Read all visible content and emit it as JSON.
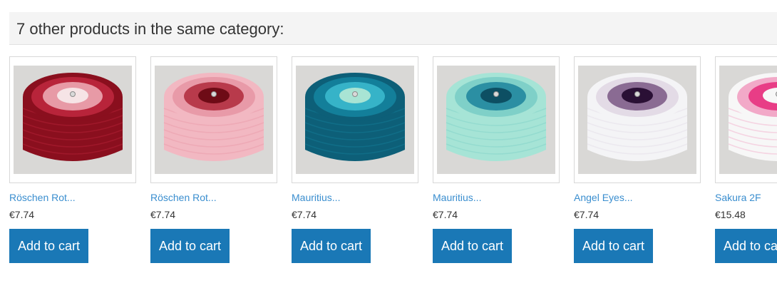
{
  "section": {
    "title": "7 other products in the same category:"
  },
  "products": [
    {
      "name": "Röschen Rot...",
      "price": "€7.74",
      "cart_label": "Add to cart",
      "image_icon": "yarn-cake-image",
      "colors": [
        "#8a0f1e",
        "#b8243a",
        "#e79aa6",
        "#f6e4e6"
      ]
    },
    {
      "name": "Röschen Rot...",
      "price": "€7.74",
      "cart_label": "Add to cart",
      "image_icon": "yarn-cake-image",
      "colors": [
        "#f2b8c2",
        "#e89aa8",
        "#b83a4b",
        "#6e0b16"
      ]
    },
    {
      "name": "Mauritius...",
      "price": "€7.74",
      "cart_label": "Add to cart",
      "image_icon": "yarn-cake-image",
      "colors": [
        "#0d5f78",
        "#137f9a",
        "#36b3c8",
        "#a8e4d4"
      ]
    },
    {
      "name": "Mauritius...",
      "price": "€7.74",
      "cart_label": "Add to cart",
      "image_icon": "yarn-cake-image",
      "colors": [
        "#a6e4d6",
        "#7fd0c8",
        "#2b8fa3",
        "#0d4f63"
      ]
    },
    {
      "name": "Angel Eyes...",
      "price": "€7.74",
      "cart_label": "Add to cart",
      "image_icon": "yarn-cake-image",
      "colors": [
        "#f4f4f6",
        "#e3dbe6",
        "#8a6b93",
        "#2a1035"
      ]
    },
    {
      "name": "Sakura 2F",
      "price": "€15.48",
      "cart_label": "Add to cart",
      "image_icon": "yarn-cake-image",
      "colors": [
        "#f7f7f7",
        "#f2a9c8",
        "#e83d86",
        "#f7f7f7"
      ]
    }
  ],
  "colors": {
    "accent": "#1a78b6",
    "link": "#3a8ecf",
    "header_bg": "#f4f4f4",
    "image_bg": "#d9d8d6"
  }
}
